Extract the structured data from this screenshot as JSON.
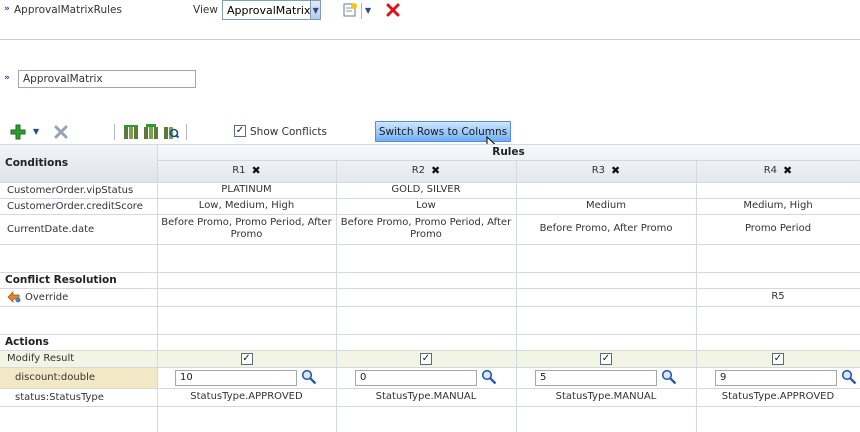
{
  "header": {
    "rules_name": "ApprovalMatrixRules",
    "view_label": "View",
    "view_selected": "ApprovalMatrix"
  },
  "matrix": {
    "name": "ApprovalMatrix"
  },
  "toolbar": {
    "show_conflicts_label": "Show Conflicts",
    "show_conflicts_checked": true,
    "switch_button_label": "Switch Rows to Columns"
  },
  "table": {
    "conditions_label": "Conditions",
    "rules_label": "Rules",
    "rules": [
      "R1",
      "R2",
      "R3",
      "R4"
    ],
    "conditions": [
      {
        "label": "CustomerOrder.vipStatus",
        "values": [
          "PLATINUM",
          "GOLD, SILVER",
          "",
          ""
        ]
      },
      {
        "label": "CustomerOrder.creditScore",
        "values": [
          "Low, Medium, High",
          "Low",
          "Medium",
          "Medium, High"
        ]
      },
      {
        "label": "CurrentDate.date",
        "values": [
          "Before Promo, Promo Period, After Promo",
          "Before Promo, Promo Period, After Promo",
          "Before Promo, After Promo",
          "Promo Period"
        ]
      }
    ],
    "conflict_label": "Conflict Resolution",
    "override_label": "Override",
    "override_values": [
      "",
      "",
      "",
      "R5"
    ],
    "actions_label": "Actions",
    "modify_result_label": "Modify Result",
    "modify_checked": [
      true,
      true,
      true,
      true
    ],
    "discount_label": "discount:double",
    "discount_values": [
      "10",
      "0",
      "5",
      "9"
    ],
    "status_label": "status:StatusType",
    "status_values": [
      "StatusType.APPROVED",
      "StatusType.MANUAL",
      "StatusType.MANUAL",
      "StatusType.APPROVED"
    ]
  },
  "colors": {
    "accent_blue": "#6fb0f5",
    "delete_red": "#d9121c",
    "add_green": "#2e9d2e",
    "highlight_row": "#f2f5e4",
    "discount_label_bg": "#f2e8c6"
  }
}
